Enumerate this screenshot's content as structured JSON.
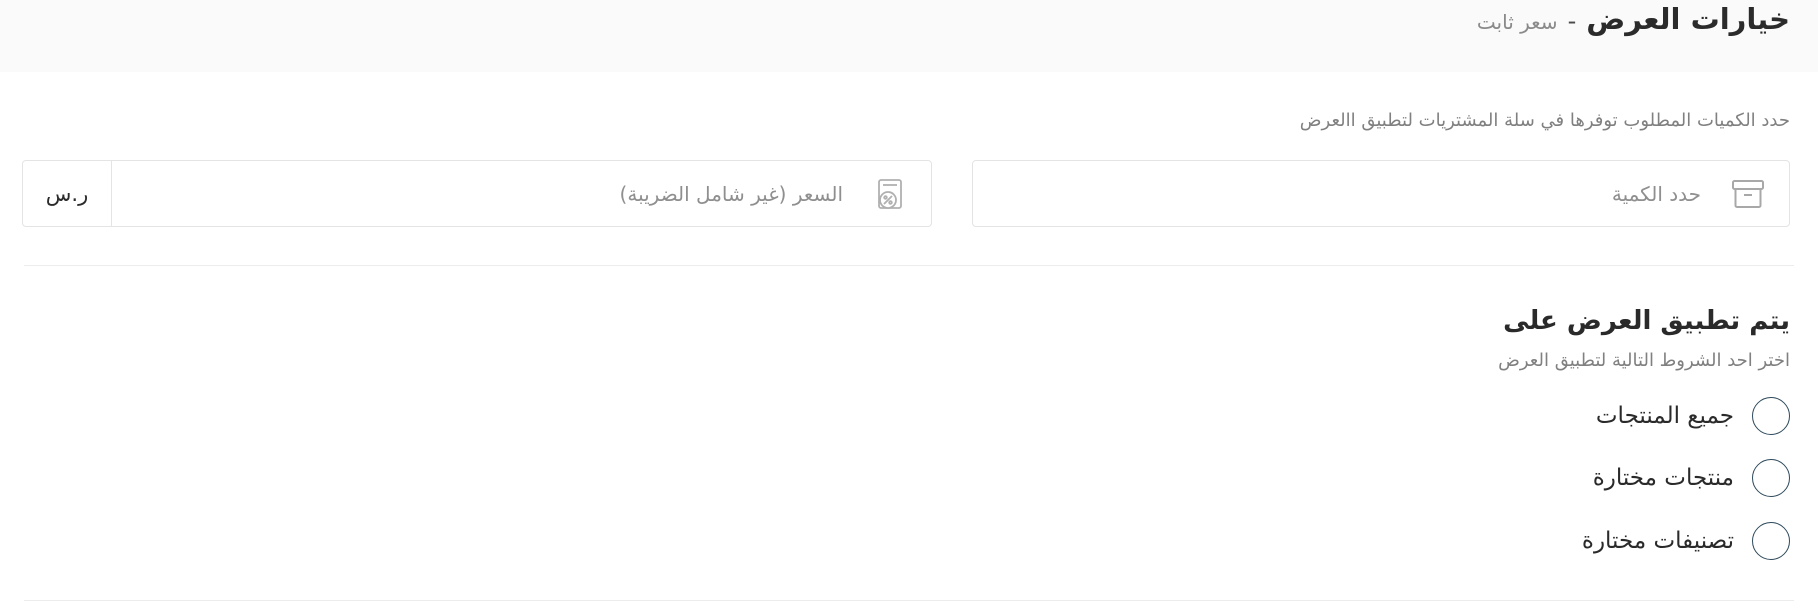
{
  "header": {
    "title": "خيارات العرض",
    "separator": "-",
    "subtitle": "سعر ثابت"
  },
  "quantity_section": {
    "instruction": "حدد الكميات المطلوب توفرها في سلة المشتريات لتطبيق االعرض",
    "quantity_field": {
      "placeholder": "حدد الكمية",
      "value": "",
      "icon": "archive-box-icon"
    },
    "price_field": {
      "placeholder": "السعر (غير شامل الضريبة)",
      "value": "",
      "icon": "discount-tag-icon",
      "currency": "ر.س"
    }
  },
  "apply_section": {
    "title": "يتم تطبيق العرض على",
    "description": "اختر احد الشروط التالية لتطبيق العرض",
    "options": [
      {
        "label": "جميع المنتجات",
        "selected": false
      },
      {
        "label": "منتجات مختارة",
        "selected": false
      },
      {
        "label": "تصنيفات مختارة",
        "selected": false
      }
    ]
  },
  "colors": {
    "header_bg": "#fafafa",
    "radio_border": "#2e4a5c",
    "muted_text": "#808080"
  }
}
